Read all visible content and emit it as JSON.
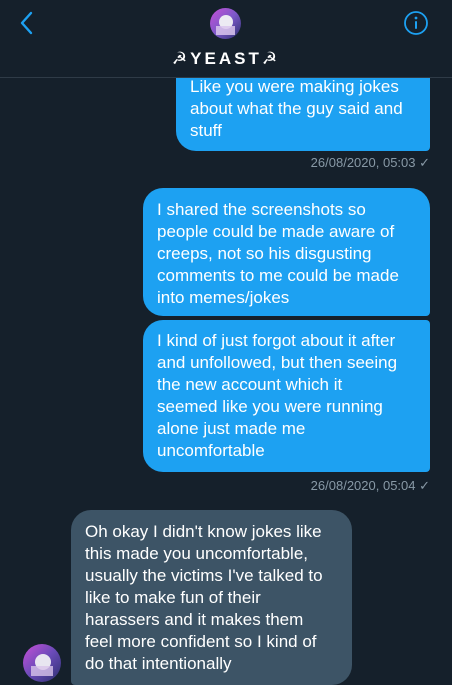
{
  "header": {
    "title": "☭YEAST☭",
    "back_icon": "chevron-left-icon",
    "info_icon": "info-icon",
    "accent_color": "#1da1f2"
  },
  "messages": [
    {
      "direction": "outgoing",
      "text": "Like you were making jokes\nabout what the guy said and\nstuff",
      "timestamp": "26/08/2020, 05:03 ✓"
    },
    {
      "direction": "outgoing",
      "text": "I shared the screenshots so\npeople could be made aware of\ncreeps, not so his disgusting\ncomments to me could be made\ninto memes/jokes"
    },
    {
      "direction": "outgoing",
      "text": "I kind of just forgot about it after\nand unfollowed, but then seeing\nthe new account which it\nseemed like you were running\nalone just made me\nuncomfortable",
      "timestamp": "26/08/2020, 05:04 ✓"
    },
    {
      "direction": "incoming",
      "text": "Oh okay I didn't know jokes like\nthis made you uncomfortable,\nusually the victims I've talked to\nlike to make fun of their\nharassers and it makes them\nfeel more confident so I kind of\ndo that intentionally"
    }
  ]
}
